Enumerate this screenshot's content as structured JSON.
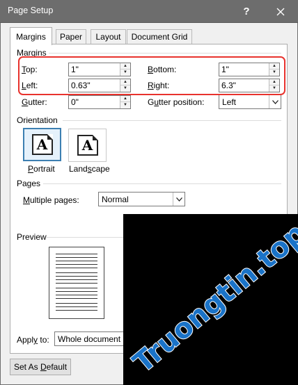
{
  "window": {
    "title": "Page Setup"
  },
  "tabs": [
    {
      "label": "Margins",
      "active": true
    },
    {
      "label": "Paper",
      "active": false
    },
    {
      "label": "Layout",
      "active": false
    },
    {
      "label": "Document Grid",
      "active": false
    }
  ],
  "margins": {
    "group_label": "Margins",
    "top": {
      "label_ul": "T",
      "label_rest": "op:",
      "value": "1\""
    },
    "bottom": {
      "label_ul": "B",
      "label_rest": "ottom:",
      "value": "1\""
    },
    "left": {
      "label_ul": "L",
      "label_rest": "eft:",
      "value": "0.63\""
    },
    "right": {
      "label_ul": "R",
      "label_rest": "ight:",
      "value": "6.3\""
    },
    "gutter": {
      "label_ul": "G",
      "label_rest": "utter:",
      "value": "0\""
    },
    "gutter_position": {
      "label_ul": "u",
      "label_pre": "G",
      "label_rest": "tter position:",
      "value": "Left"
    }
  },
  "orientation": {
    "group_label": "Orientation",
    "glyph": "A",
    "portrait": {
      "label_ul": "P",
      "label_rest": "ortrait",
      "selected": true
    },
    "landscape": {
      "label_ul": "s",
      "label_pre": "Land",
      "label_rest": "cape",
      "selected": false
    }
  },
  "pages": {
    "group_label": "Pages",
    "multiple_pages": {
      "label_ul": "M",
      "label_rest": "ultiple pages:",
      "value": "Normal"
    }
  },
  "preview": {
    "group_label": "Preview"
  },
  "apply_to": {
    "label_pre": "Appl",
    "label_ul": "y",
    "label_rest": " to:",
    "value": "Whole document"
  },
  "buttons": {
    "default_pre": "Set As ",
    "default_ul": "D",
    "default_rest": "efault"
  },
  "watermark": {
    "text": "Truongtin.top",
    "color": "#1a73c8"
  },
  "colors": {
    "titlebar": "#6d6d6d",
    "highlight": "#e8322d",
    "selected": "#3c7fb1"
  }
}
